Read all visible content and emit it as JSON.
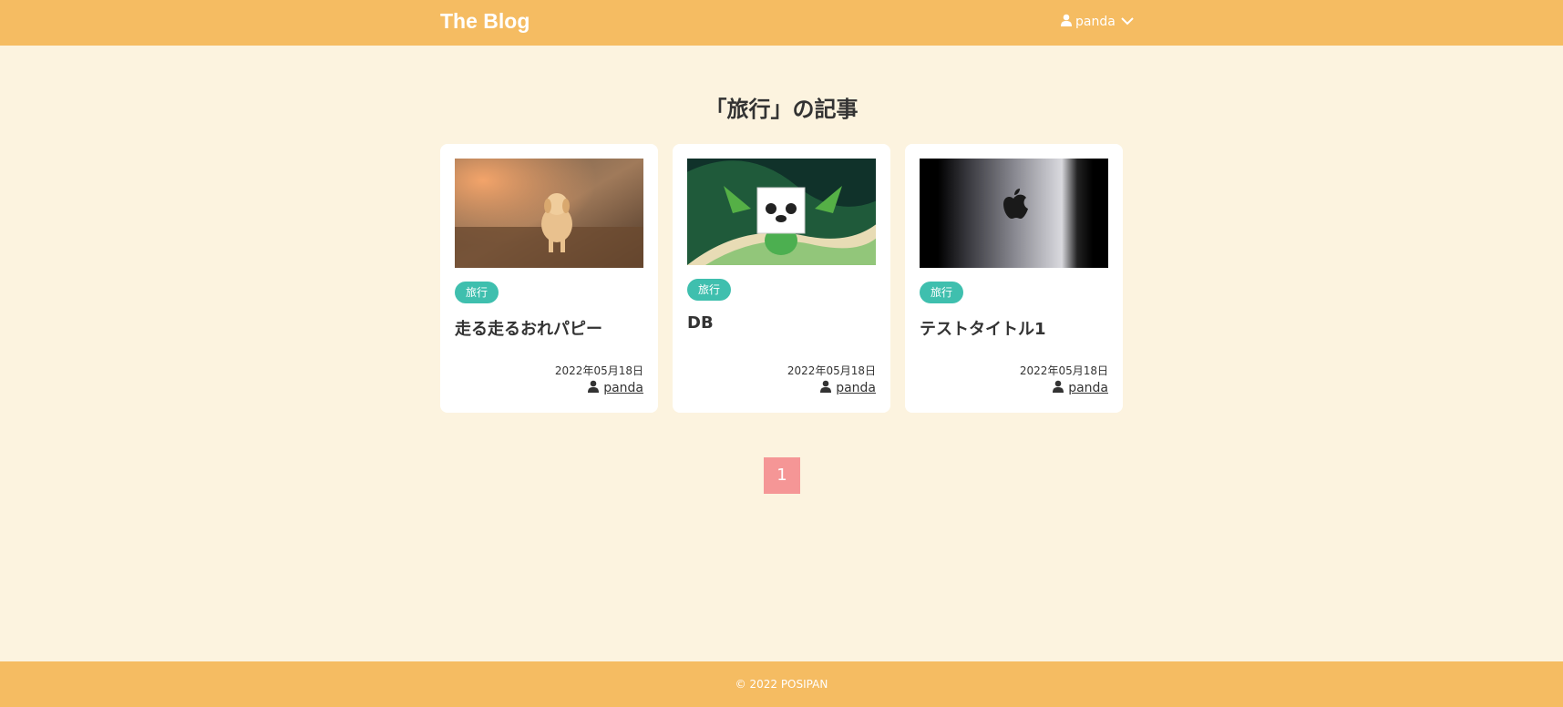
{
  "header": {
    "logo": "The Blog",
    "user_name": "panda"
  },
  "page": {
    "title": "「旅行」の記事"
  },
  "posts": [
    {
      "tag": "旅行",
      "title": "走る走るおれパピー",
      "date": "2022年05月18日",
      "author": "panda",
      "thumb": "puppy-photo"
    },
    {
      "tag": "旅行",
      "title": "DB",
      "date": "2022年05月18日",
      "author": "panda",
      "thumb": "dragon-panda-illustration"
    },
    {
      "tag": "旅行",
      "title": "テストタイトル1",
      "date": "2022年05月18日",
      "author": "panda",
      "thumb": "apple-logo-photo"
    }
  ],
  "pagination": {
    "current": "1"
  },
  "footer": {
    "copyright": "© 2022 POSIPAN"
  },
  "colors": {
    "header_bg": "#f5bc62",
    "page_bg": "#fcf3df",
    "tag_bg": "#3fbfae",
    "pager_bg": "#f59696"
  }
}
